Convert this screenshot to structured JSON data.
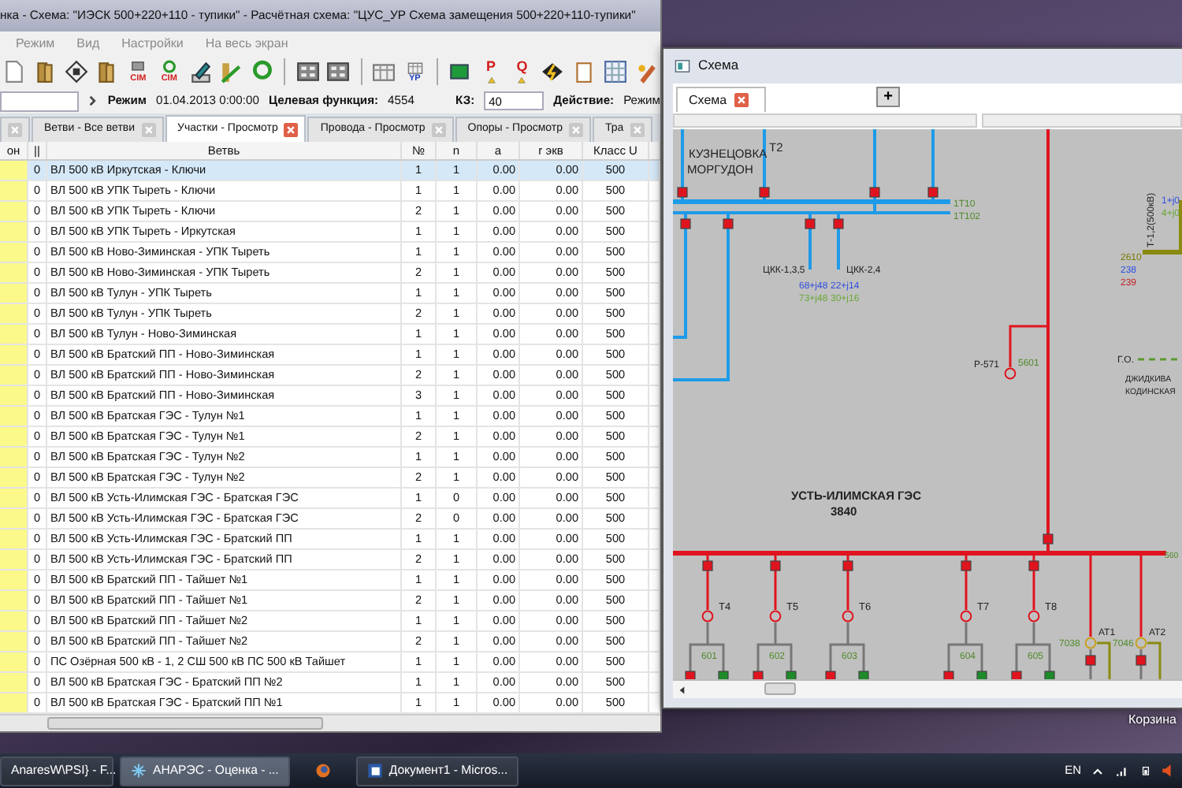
{
  "main_window": {
    "title": "нка - Схема: \"ИЭСК 500+220+110 - тупики\" - Расчётная схема: \"ЦУС_УР Схема замещения 500+220+110-тупики\"",
    "menu": [
      "Режим",
      "Вид",
      "Настройки",
      "На весь экран"
    ],
    "toolbar": [
      {
        "kind": "page"
      },
      {
        "kind": "folder"
      },
      {
        "kind": "disk"
      },
      {
        "kind": "folder"
      },
      {
        "kind": "database",
        "label": "CIM"
      },
      {
        "kind": "recycle",
        "label": "CIM"
      },
      {
        "kind": "pencil"
      },
      {
        "kind": "chart"
      },
      {
        "kind": "recycle"
      },
      {
        "kind": "separator"
      },
      {
        "kind": "calculator"
      },
      {
        "kind": "calculator"
      },
      {
        "kind": "separator"
      },
      {
        "kind": "table"
      },
      {
        "kind": "table",
        "label": "YP"
      },
      {
        "kind": "separator"
      },
      {
        "kind": "monitor"
      },
      {
        "kind": "warning",
        "label": "P"
      },
      {
        "kind": "warning",
        "label": "Q"
      },
      {
        "kind": "lightning"
      },
      {
        "kind": "clipboard"
      },
      {
        "kind": "spreadsheet"
      },
      {
        "kind": "brush"
      }
    ],
    "mode_bar": {
      "mode_label": "Режим",
      "mode_value": "01.04.2013 0:00:00",
      "objective_label": "Целевая функция:",
      "objective_value": "4554",
      "kz_label": "КЗ:",
      "kz_value": "40",
      "action_label": "Действие:",
      "action_value": "Режим"
    },
    "tabs": [
      {
        "selected": false
      },
      {
        "label": "Ветви - Все ветви",
        "selected": false
      },
      {
        "label": "Участки - Просмотр",
        "selected": true
      },
      {
        "label": "Провода - Просмотр",
        "selected": false
      },
      {
        "label": "Опоры - Просмотр",
        "selected": false
      },
      {
        "label": "Тра",
        "selected": false
      }
    ],
    "table": {
      "columns": [
        "он",
        "||",
        "Ветвь",
        "№",
        "n",
        "a",
        "r экв",
        "Класс U"
      ],
      "rows": [
        {
          "selected": true,
          "cells": [
            "",
            "0",
            "ВЛ 500 кВ Иркутская - Ключи",
            "1",
            "1",
            "0.00",
            "0.00",
            "500"
          ]
        },
        {
          "selected": false,
          "cells": [
            "",
            "0",
            "ВЛ 500 кВ УПК Тыреть - Ключи",
            "1",
            "1",
            "0.00",
            "0.00",
            "500"
          ]
        },
        {
          "selected": false,
          "cells": [
            "",
            "0",
            "ВЛ 500 кВ УПК Тыреть - Ключи",
            "2",
            "1",
            "0.00",
            "0.00",
            "500"
          ]
        },
        {
          "selected": false,
          "cells": [
            "",
            "0",
            "ВЛ 500 кВ УПК Тыреть - Иркутская",
            "1",
            "1",
            "0.00",
            "0.00",
            "500"
          ]
        },
        {
          "selected": false,
          "cells": [
            "",
            "0",
            "ВЛ 500 кВ Ново-Зиминская - УПК Тыреть",
            "1",
            "1",
            "0.00",
            "0.00",
            "500"
          ]
        },
        {
          "selected": false,
          "cells": [
            "",
            "0",
            "ВЛ 500 кВ Ново-Зиминская - УПК Тыреть",
            "2",
            "1",
            "0.00",
            "0.00",
            "500"
          ]
        },
        {
          "selected": false,
          "cells": [
            "",
            "0",
            "ВЛ 500 кВ Тулун - УПК Тыреть",
            "1",
            "1",
            "0.00",
            "0.00",
            "500"
          ]
        },
        {
          "selected": false,
          "cells": [
            "",
            "0",
            "ВЛ 500 кВ Тулун - УПК Тыреть",
            "2",
            "1",
            "0.00",
            "0.00",
            "500"
          ]
        },
        {
          "selected": false,
          "cells": [
            "",
            "0",
            "ВЛ 500 кВ Тулун - Ново-Зиминская",
            "1",
            "1",
            "0.00",
            "0.00",
            "500"
          ]
        },
        {
          "selected": false,
          "cells": [
            "",
            "0",
            "ВЛ 500 кВ Братский ПП - Ново-Зиминская",
            "1",
            "1",
            "0.00",
            "0.00",
            "500"
          ]
        },
        {
          "selected": false,
          "cells": [
            "",
            "0",
            "ВЛ 500 кВ Братский ПП - Ново-Зиминская",
            "2",
            "1",
            "0.00",
            "0.00",
            "500"
          ]
        },
        {
          "selected": false,
          "cells": [
            "",
            "0",
            "ВЛ 500 кВ Братский ПП - Ново-Зиминская",
            "3",
            "1",
            "0.00",
            "0.00",
            "500"
          ]
        },
        {
          "selected": false,
          "cells": [
            "",
            "0",
            "ВЛ 500 кВ Братская ГЭС - Тулун №1",
            "1",
            "1",
            "0.00",
            "0.00",
            "500"
          ]
        },
        {
          "selected": false,
          "cells": [
            "",
            "0",
            "ВЛ 500 кВ Братская ГЭС - Тулун №1",
            "2",
            "1",
            "0.00",
            "0.00",
            "500"
          ]
        },
        {
          "selected": false,
          "cells": [
            "",
            "0",
            "ВЛ 500 кВ Братская ГЭС - Тулун №2",
            "1",
            "1",
            "0.00",
            "0.00",
            "500"
          ]
        },
        {
          "selected": false,
          "cells": [
            "",
            "0",
            "ВЛ 500 кВ Братская ГЭС - Тулун №2",
            "2",
            "1",
            "0.00",
            "0.00",
            "500"
          ]
        },
        {
          "selected": false,
          "cells": [
            "",
            "0",
            "ВЛ 500 кВ Усть-Илимская ГЭС - Братская ГЭС",
            "1",
            "0",
            "0.00",
            "0.00",
            "500"
          ]
        },
        {
          "selected": false,
          "cells": [
            "",
            "0",
            "ВЛ 500 кВ Усть-Илимская ГЭС - Братская ГЭС",
            "2",
            "0",
            "0.00",
            "0.00",
            "500"
          ]
        },
        {
          "selected": false,
          "cells": [
            "",
            "0",
            "ВЛ 500 кВ Усть-Илимская ГЭС - Братский ПП",
            "1",
            "1",
            "0.00",
            "0.00",
            "500"
          ]
        },
        {
          "selected": false,
          "cells": [
            "",
            "0",
            "ВЛ 500 кВ Усть-Илимская ГЭС - Братский ПП",
            "2",
            "1",
            "0.00",
            "0.00",
            "500"
          ]
        },
        {
          "selected": false,
          "cells": [
            "",
            "0",
            "ВЛ 500 кВ Братский ПП - Тайшет №1",
            "1",
            "1",
            "0.00",
            "0.00",
            "500"
          ]
        },
        {
          "selected": false,
          "cells": [
            "",
            "0",
            "ВЛ 500 кВ Братский ПП - Тайшет №1",
            "2",
            "1",
            "0.00",
            "0.00",
            "500"
          ]
        },
        {
          "selected": false,
          "cells": [
            "",
            "0",
            "ВЛ 500 кВ Братский ПП - Тайшет №2",
            "1",
            "1",
            "0.00",
            "0.00",
            "500"
          ]
        },
        {
          "selected": false,
          "cells": [
            "",
            "0",
            "ВЛ 500 кВ Братский ПП - Тайшет №2",
            "2",
            "1",
            "0.00",
            "0.00",
            "500"
          ]
        },
        {
          "selected": false,
          "cells": [
            "",
            "0",
            "ПС Озёрная 500 кВ - 1, 2 СШ 500 кВ ПС 500 кВ Тайшет",
            "1",
            "1",
            "0.00",
            "0.00",
            "500"
          ]
        },
        {
          "selected": false,
          "cells": [
            "",
            "0",
            "ВЛ 500 кВ Братская ГЭС - Братский ПП №2",
            "1",
            "1",
            "0.00",
            "0.00",
            "500"
          ]
        },
        {
          "selected": false,
          "cells": [
            "",
            "0",
            "ВЛ 500 кВ Братская ГЭС - Братский ПП №1",
            "1",
            "1",
            "0.00",
            "0.00",
            "500"
          ]
        }
      ]
    }
  },
  "schema_window": {
    "title": "Схема",
    "tabs": [
      {
        "label": "Схема",
        "selected": true
      }
    ],
    "add_button": "+",
    "diagram": {
      "labels": [
        {
          "text": "КУЗНЕЦОВКА",
          "color": "#222222",
          "kind": "name"
        },
        {
          "text": "МОРГУДОН",
          "color": "#222222",
          "kind": "name"
        },
        {
          "text": "T2",
          "color": "#222222",
          "kind": "name"
        },
        {
          "text": "1Т10",
          "color": "#4f8a2a",
          "kind": "value"
        },
        {
          "text": "1Т102",
          "color": "#4f8a2a",
          "kind": "value"
        },
        {
          "text": "ЦКК-1,3,5",
          "color": "#222222",
          "kind": "value"
        },
        {
          "text": "ЦКК-2,4",
          "color": "#222222",
          "kind": "value"
        },
        {
          "text": "68+j48",
          "color": "#2f4fe0",
          "kind": "value"
        },
        {
          "text": "73+j48",
          "color": "#6aa838",
          "kind": "value"
        },
        {
          "text": "22+j14",
          "color": "#2f4fe0",
          "kind": "value"
        },
        {
          "text": "30+j16",
          "color": "#6aa838",
          "kind": "value"
        },
        {
          "text": "Т-1,2(500кВ)",
          "color": "#222222",
          "kind": "vertical"
        },
        {
          "text": "1+j0",
          "color": "#2f4fe0",
          "kind": "value"
        },
        {
          "text": "4+j0",
          "color": "#6aa838",
          "kind": "value"
        },
        {
          "text": "2610",
          "color": "#7a7a00",
          "kind": "value"
        },
        {
          "text": "238",
          "color": "#2f4fe0",
          "kind": "value"
        },
        {
          "text": "239",
          "color": "#c0202a",
          "kind": "value"
        },
        {
          "text": "P-571",
          "color": "#222222",
          "kind": "value"
        },
        {
          "text": "5601",
          "color": "#4f8a2a",
          "kind": "value"
        },
        {
          "text": "Г.О.",
          "color": "#222222",
          "kind": "value"
        },
        {
          "text": "ДЖИДКИВА",
          "color": "#222222",
          "kind": "value"
        },
        {
          "text": "КОДИНСКАЯ",
          "color": "#222222",
          "kind": "value"
        },
        {
          "text": "УСТЬ-ИЛИМСКАЯ ГЭС",
          "color": "#222222",
          "kind": "title"
        },
        {
          "text": "3840",
          "color": "#222222",
          "kind": "title"
        },
        {
          "text": "Т4",
          "color": "#222222",
          "kind": "value"
        },
        {
          "text": "Т5",
          "color": "#222222",
          "kind": "value"
        },
        {
          "text": "Т6",
          "color": "#222222",
          "kind": "value"
        },
        {
          "text": "Т7",
          "color": "#222222",
          "kind": "value"
        },
        {
          "text": "Т8",
          "color": "#222222",
          "kind": "value"
        },
        {
          "text": "601",
          "color": "#4f8a2a",
          "kind": "value"
        },
        {
          "text": "602",
          "color": "#4f8a2a",
          "kind": "value"
        },
        {
          "text": "603",
          "color": "#4f8a2a",
          "kind": "value"
        },
        {
          "text": "604",
          "color": "#4f8a2a",
          "kind": "value"
        },
        {
          "text": "605",
          "color": "#4f8a2a",
          "kind": "value"
        },
        {
          "text": "AT1",
          "color": "#222222",
          "kind": "value"
        },
        {
          "text": "AT2",
          "color": "#222222",
          "kind": "value"
        },
        {
          "text": "7038",
          "color": "#4f8a2a",
          "kind": "value"
        },
        {
          "text": "7046",
          "color": "#4f8a2a",
          "kind": "value"
        },
        {
          "text": "560",
          "color": "#4f8a2a",
          "kind": "value"
        }
      ]
    }
  },
  "desktop": {
    "icon_label": "Корзина"
  },
  "taskbar": {
    "items": [
      {
        "kind": "window",
        "label": "AnaresW\\PSI} - F...",
        "selected": false
      },
      {
        "kind": "app",
        "label": "АНАРЭС - Оценка - ...",
        "selected": true
      },
      {
        "kind": "browser",
        "selected": false
      },
      {
        "kind": "document",
        "label": "Документ1 - Micros...",
        "selected": false
      }
    ],
    "language": "EN"
  }
}
